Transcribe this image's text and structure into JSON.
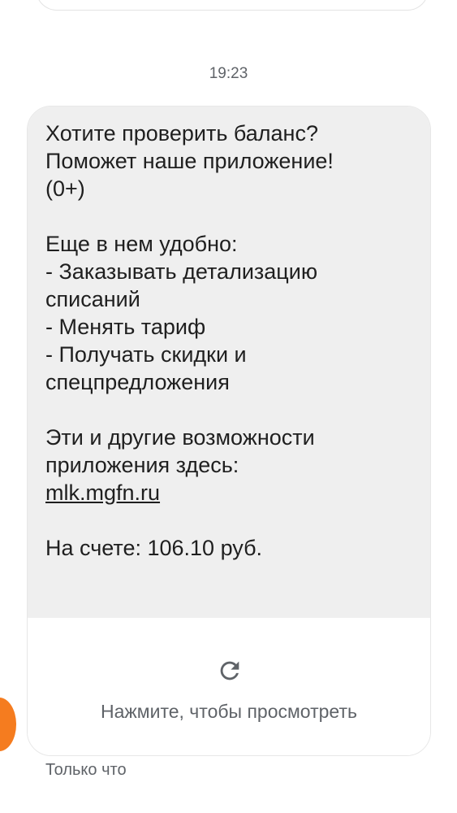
{
  "conversation": {
    "timestamp": "19:23",
    "message": {
      "lines": [
        "Хотите проверить баланс?",
        "Поможет наше приложение!",
        "(0+)",
        "",
        "Еще в нем удобно:",
        "- Заказывать детализацию",
        "списаний",
        "- Менять тариф",
        "- Получать скидки и",
        "спецпредложения",
        "",
        "Эти и другие возможности",
        "приложения здесь:"
      ],
      "link": "mlk.mgfn.ru",
      "balance": "На счете: 106.10 руб."
    },
    "preview": {
      "icon": "reload-icon",
      "label": "Нажмите, чтобы просмотреть"
    },
    "status": "Только что",
    "colors": {
      "bubble_bg": "#efefef",
      "avatar": "#f57c1f",
      "secondary_text": "#5f6368"
    }
  }
}
